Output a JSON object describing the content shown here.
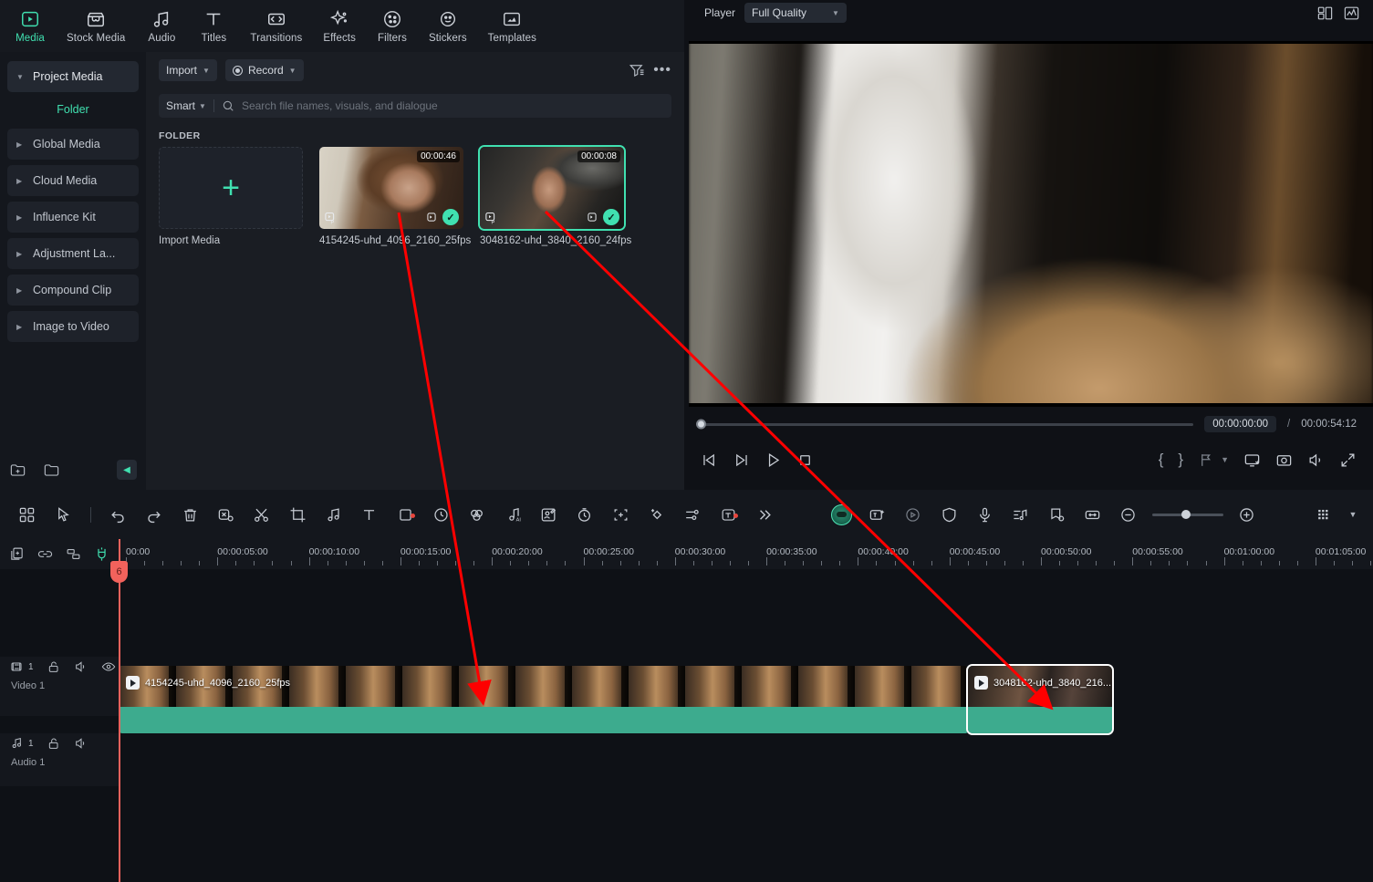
{
  "tabs": [
    {
      "label": "Media",
      "icon": "media-icon",
      "active": true
    },
    {
      "label": "Stock Media",
      "icon": "stock-media-icon",
      "active": false
    },
    {
      "label": "Audio",
      "icon": "audio-icon",
      "active": false
    },
    {
      "label": "Titles",
      "icon": "titles-icon",
      "active": false
    },
    {
      "label": "Transitions",
      "icon": "transitions-icon",
      "active": false
    },
    {
      "label": "Effects",
      "icon": "effects-icon",
      "active": false
    },
    {
      "label": "Filters",
      "icon": "filters-icon",
      "active": false
    },
    {
      "label": "Stickers",
      "icon": "stickers-icon",
      "active": false
    },
    {
      "label": "Templates",
      "icon": "templates-icon",
      "active": false
    }
  ],
  "sidebar": {
    "root": "Project Media",
    "sub": "Folder",
    "items": [
      {
        "label": "Global Media"
      },
      {
        "label": "Cloud Media"
      },
      {
        "label": "Influence Kit"
      },
      {
        "label": "Adjustment La..."
      },
      {
        "label": "Compound Clip"
      },
      {
        "label": "Image to Video"
      }
    ]
  },
  "media": {
    "import_label": "Import",
    "record_label": "Record",
    "smart_label": "Smart",
    "search_placeholder": "Search file names, visuals, and dialogue",
    "search_value": "",
    "section_label": "FOLDER",
    "import_cell_caption": "Import Media",
    "items": [
      {
        "name": "4154245-uhd_4096_2160_25fps",
        "duration": "00:00:46",
        "selected": false
      },
      {
        "name": "3048162-uhd_3840_2160_24fps",
        "duration": "00:00:08",
        "selected": true
      }
    ]
  },
  "player": {
    "title": "Player",
    "quality": "Full Quality",
    "current_time": "00:00:00:00",
    "separator": "/",
    "total_time": "00:00:54:12",
    "mark_in": "{",
    "mark_out": "}"
  },
  "timeline": {
    "ruler_ticks": [
      "00:00",
      "00:00:05:00",
      "00:00:10:00",
      "00:00:15:00",
      "00:00:20:00",
      "00:00:25:00",
      "00:00:30:00",
      "00:00:35:00",
      "00:00:40:00",
      "00:00:45:00",
      "00:00:50:00",
      "00:00:55:00",
      "00:01:00:00",
      "00:01:05:00"
    ],
    "playhead_flag": "6",
    "tracks": [
      {
        "name": "Video 1",
        "number": "1",
        "type": "video"
      },
      {
        "name": "Audio 1",
        "number": "1",
        "type": "audio"
      }
    ],
    "clips": [
      {
        "label": "4154245-uhd_4096_2160_25fps",
        "selected": false
      },
      {
        "label": "3048162-uhd_3840_216...",
        "selected": true
      }
    ]
  },
  "colors": {
    "accent": "#40e0b0",
    "clip": "#3dab8e",
    "playhead": "#f2625c",
    "annotation": "#fe0000",
    "panel_bg": "#1a1d23",
    "toolbar_bg": "#14171d"
  }
}
